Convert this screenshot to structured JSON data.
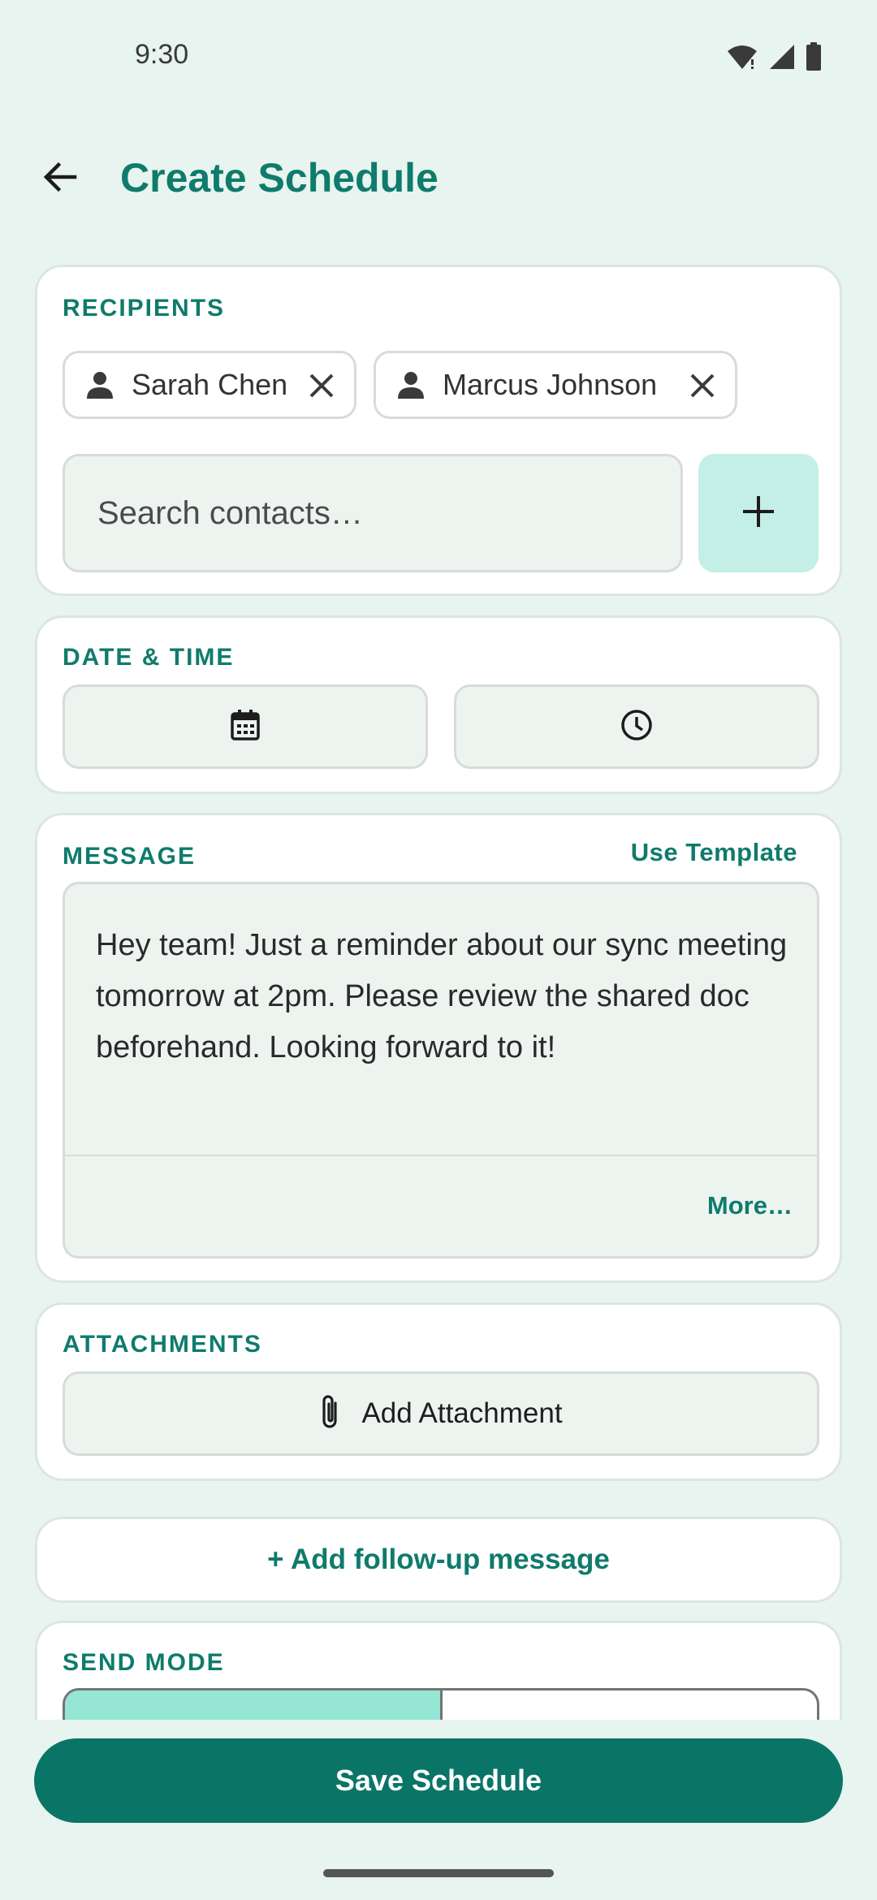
{
  "status_bar": {
    "time": "9:30"
  },
  "header": {
    "title": "Create Schedule"
  },
  "recipients": {
    "label": "RECIPIENTS",
    "chips": [
      {
        "name": "Sarah Chen"
      },
      {
        "name": "Marcus Johnson"
      }
    ],
    "search_placeholder": "Search contacts…"
  },
  "date_time": {
    "label": "DATE & TIME"
  },
  "message": {
    "label": "MESSAGE",
    "template_link": "Use Template",
    "body": "Hey team! Just a reminder about our sync meeting tomorrow at 2pm. Please review the shared doc beforehand. Looking forward to it!",
    "more_link": "More…"
  },
  "attachments": {
    "label": "ATTACHMENTS",
    "button_label": "Add Attachment"
  },
  "followup": {
    "label": "+ Add follow-up message"
  },
  "send_mode": {
    "label": "SEND MODE"
  },
  "footer": {
    "save_label": "Save Schedule"
  },
  "colors": {
    "accent": "#0f7b6c",
    "background": "#e8f4ef",
    "add_button": "#c4efe7",
    "segment_active": "#96e6d6",
    "save_button": "#0a7467"
  },
  "icons": [
    "wifi-icon",
    "signal-icon",
    "battery-icon",
    "back-arrow-icon",
    "person-icon",
    "close-icon",
    "plus-icon",
    "calendar-icon",
    "clock-icon",
    "paperclip-icon"
  ]
}
